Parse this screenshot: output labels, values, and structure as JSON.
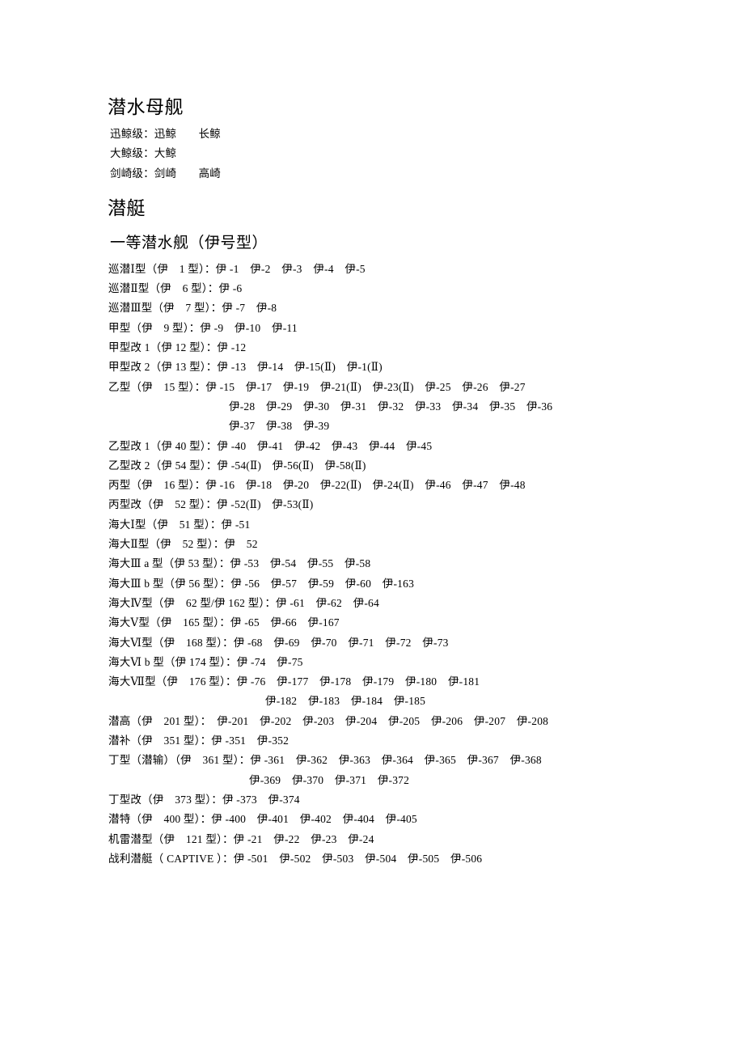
{
  "document": {
    "sections": [
      {
        "id": "submarine-tenders",
        "heading": "潜水母舰",
        "lines": [
          "迅鲸级：迅鲸　　长鲸",
          "大鲸级：大鲸",
          "剑崎级：剑崎　　高崎"
        ]
      },
      {
        "id": "submarines",
        "heading": "潜艇",
        "subheading": "一等潜水舰（伊号型）",
        "lines": [
          {
            "text": "巡潜Ⅰ型（伊　1 型）：伊 -1　伊-2　伊-3　伊-4　伊-5",
            "indent": "none"
          },
          {
            "text": "巡潜Ⅱ型（伊　6 型）：伊 -6",
            "indent": "none"
          },
          {
            "text": "巡潜Ⅲ型（伊　7 型）：伊 -7　伊-8",
            "indent": "none"
          },
          {
            "text": "甲型（伊　9 型）：伊 -9　伊-10　伊-11",
            "indent": "none"
          },
          {
            "text": "甲型改 1（伊 12 型）：伊 -12",
            "indent": "none"
          },
          {
            "text": "甲型改 2（伊 13 型）：伊 -13　伊-14　伊-15(Ⅱ)　伊-1(Ⅱ)",
            "indent": "none"
          },
          {
            "text": "乙型（伊　15 型）：伊 -15　伊-17　伊-19　伊-21(Ⅱ)　伊-23(Ⅱ)　伊-25　伊-26　伊-27",
            "indent": "none"
          },
          {
            "text": "伊-28　伊-29　伊-30　伊-31　伊-32　伊-33　伊-34　伊-35　伊-36",
            "indent": "cont-1"
          },
          {
            "text": "伊-37　伊-38　伊-39",
            "indent": "cont-1"
          },
          {
            "text": "乙型改 1（伊 40 型）：伊 -40　伊-41　伊-42　伊-43　伊-44　伊-45",
            "indent": "none"
          },
          {
            "text": "乙型改 2（伊 54 型）：伊 -54(Ⅱ)　伊-56(Ⅱ)　伊-58(Ⅱ)",
            "indent": "none"
          },
          {
            "text": "丙型（伊　16 型）：伊 -16　伊-18　伊-20　伊-22(Ⅱ)　伊-24(Ⅱ)　伊-46　伊-47　伊-48",
            "indent": "none"
          },
          {
            "text": "丙型改（伊　52 型）：伊 -52(Ⅱ)　伊-53(Ⅱ)",
            "indent": "none"
          },
          {
            "text": "海大Ⅰ型（伊　51 型）：伊 -51",
            "indent": "none"
          },
          {
            "text": "海大Ⅱ型（伊　52 型）：伊　52",
            "indent": "none"
          },
          {
            "text": "海大Ⅲ a 型（伊 53 型）：伊 -53　伊-54　伊-55　伊-58",
            "indent": "none"
          },
          {
            "text": "海大Ⅲ b 型（伊 56 型）：伊 -56　伊-57　伊-59　伊-60　伊-163",
            "indent": "none"
          },
          {
            "text": "海大Ⅳ型（伊　62 型/伊 162 型）：伊 -61　伊-62　伊-64",
            "indent": "none"
          },
          {
            "text": "海大Ⅴ型（伊　165 型）：伊 -65　伊-66　伊-167",
            "indent": "none"
          },
          {
            "text": "海大Ⅵ型（伊　168 型）：伊 -68　伊-69　伊-70　伊-71　伊-72　伊-73",
            "indent": "none"
          },
          {
            "text": "海大Ⅵ b 型（伊 174 型）：伊 -74　伊-75",
            "indent": "none"
          },
          {
            "text": "海大Ⅶ型（伊　176 型）：伊 -76　伊-177　伊-178　伊-179　伊-180　伊-181",
            "indent": "none"
          },
          {
            "text": "伊-182　伊-183　伊-184　伊-185",
            "indent": "cont-2"
          },
          {
            "text": "潜高（伊　201 型）：　伊-201　伊-202　伊-203　伊-204　伊-205　伊-206　伊-207　伊-208",
            "indent": "none"
          },
          {
            "text": "潜补（伊　351 型）：伊 -351　伊-352",
            "indent": "none"
          },
          {
            "text": "丁型（潜输）（伊　361 型）：伊 -361　伊-362　伊-363　伊-364　伊-365　伊-367　伊-368",
            "indent": "none"
          },
          {
            "text": "伊-369　伊-370　伊-371　伊-372",
            "indent": "cont-3"
          },
          {
            "text": "丁型改（伊　373 型）：伊 -373　伊-374",
            "indent": "none"
          },
          {
            "text": "潜特（伊　400 型）：伊 -400　伊-401　伊-402　伊-404　伊-405",
            "indent": "none"
          },
          {
            "text": "机雷潜型（伊　121 型）：伊 -21　伊-22　伊-23　伊-24",
            "indent": "none"
          },
          {
            "text": "战利潜艇（ CAPTIVE ）：伊 -501　伊-502　伊-503　伊-504　伊-505　伊-506",
            "indent": "none"
          }
        ]
      }
    ]
  }
}
